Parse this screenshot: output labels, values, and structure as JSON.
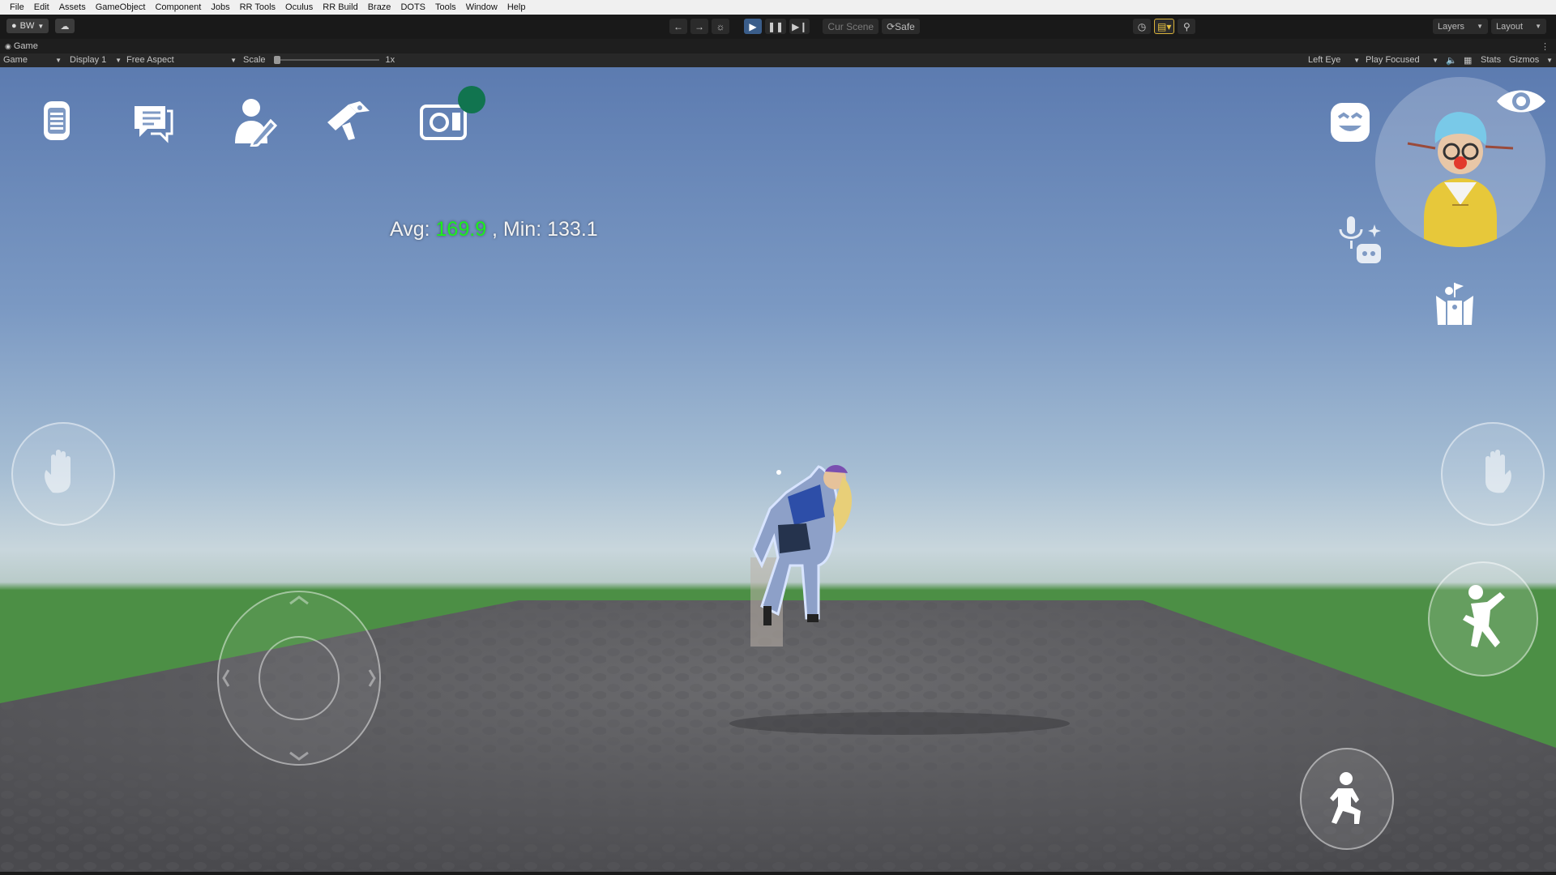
{
  "menu": [
    "File",
    "Edit",
    "Assets",
    "GameObject",
    "Component",
    "Jobs",
    "RR Tools",
    "Oculus",
    "RR Build",
    "Braze",
    "DOTS",
    "Tools",
    "Window",
    "Help"
  ],
  "toolbar": {
    "account": "BW",
    "cur_scene": "Cur Scene",
    "safe": "Safe",
    "layers": "Layers",
    "layout": "Layout"
  },
  "tab": {
    "title": "Game"
  },
  "gamebar": {
    "mode": "Game",
    "display": "Display 1",
    "aspect": "Free Aspect",
    "scale_label": "Scale",
    "scale_value": "1x",
    "eye": "Left Eye",
    "play_mode": "Play Focused",
    "stats": "Stats",
    "gizmos": "Gizmos"
  },
  "hud": {
    "fps_avg_label": "Avg: ",
    "fps_avg": "169.9",
    "fps_min_label": " , Min: ",
    "fps_min": "133.1",
    "icons": [
      "watch-menu-icon",
      "chat-icon",
      "profile-edit-icon",
      "maker-pen-icon",
      "camera-icon",
      "emote-face-icon",
      "view-eye-icon",
      "voice-bot-icon",
      "photo-pose-icon",
      "wave-hand-icon",
      "jump-icon",
      "crouch-icon",
      "joystick"
    ]
  },
  "colors": {
    "record_dot": "#11744f",
    "fps_green": "#1cf01c",
    "play_active": "#3a5d8a"
  }
}
